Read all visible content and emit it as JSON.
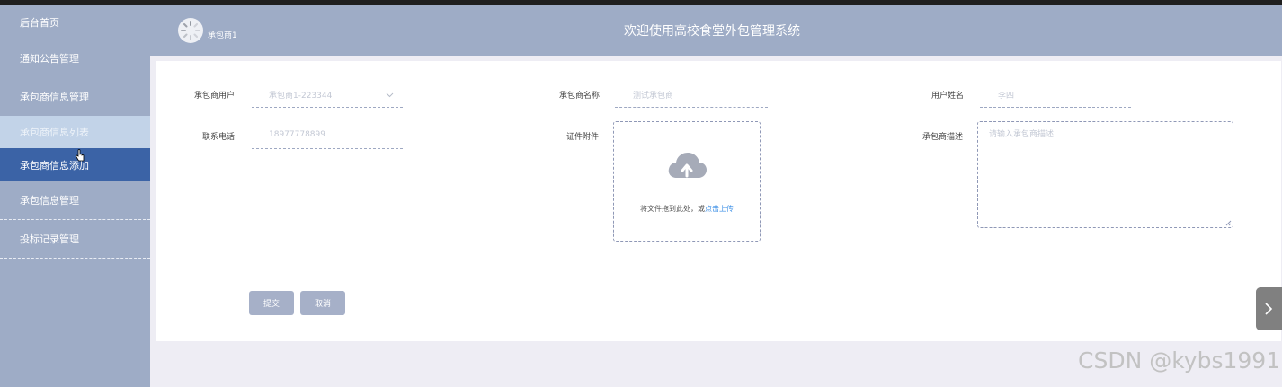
{
  "sidebar": {
    "items": [
      {
        "label": "后台首页"
      },
      {
        "label": "通知公告管理"
      },
      {
        "label": "承包商信息管理"
      },
      {
        "label": "承包商信息列表"
      },
      {
        "label": "承包商信息添加"
      },
      {
        "label": "承包信息管理"
      },
      {
        "label": "投标记录管理"
      }
    ]
  },
  "header": {
    "username": "承包商1",
    "system_title": "欢迎使用高校食堂外包管理系统"
  },
  "form": {
    "contractor_user_label": "承包商用户",
    "contractor_user_value": "承包商1-223344",
    "contractor_name_label": "承包商名称",
    "contractor_name_value": "测试承包商",
    "user_name_label": "用户姓名",
    "user_name_value": "李四",
    "phone_label": "联系电话",
    "phone_value": "18977778899",
    "certificate_label": "证件附件",
    "upload_text": "将文件拖到此处，或",
    "upload_link": "点击上传",
    "description_label": "承包商描述",
    "description_placeholder": "请输入承包商描述"
  },
  "buttons": {
    "submit": "提交",
    "cancel": "取消"
  },
  "watermark": "CSDN @kybs1991",
  "colors": {
    "sidebar_bg": "#9eacc6",
    "active_item": "#3b63a6",
    "hover_item": "#c2d3e8",
    "link": "#3a8ee6"
  }
}
